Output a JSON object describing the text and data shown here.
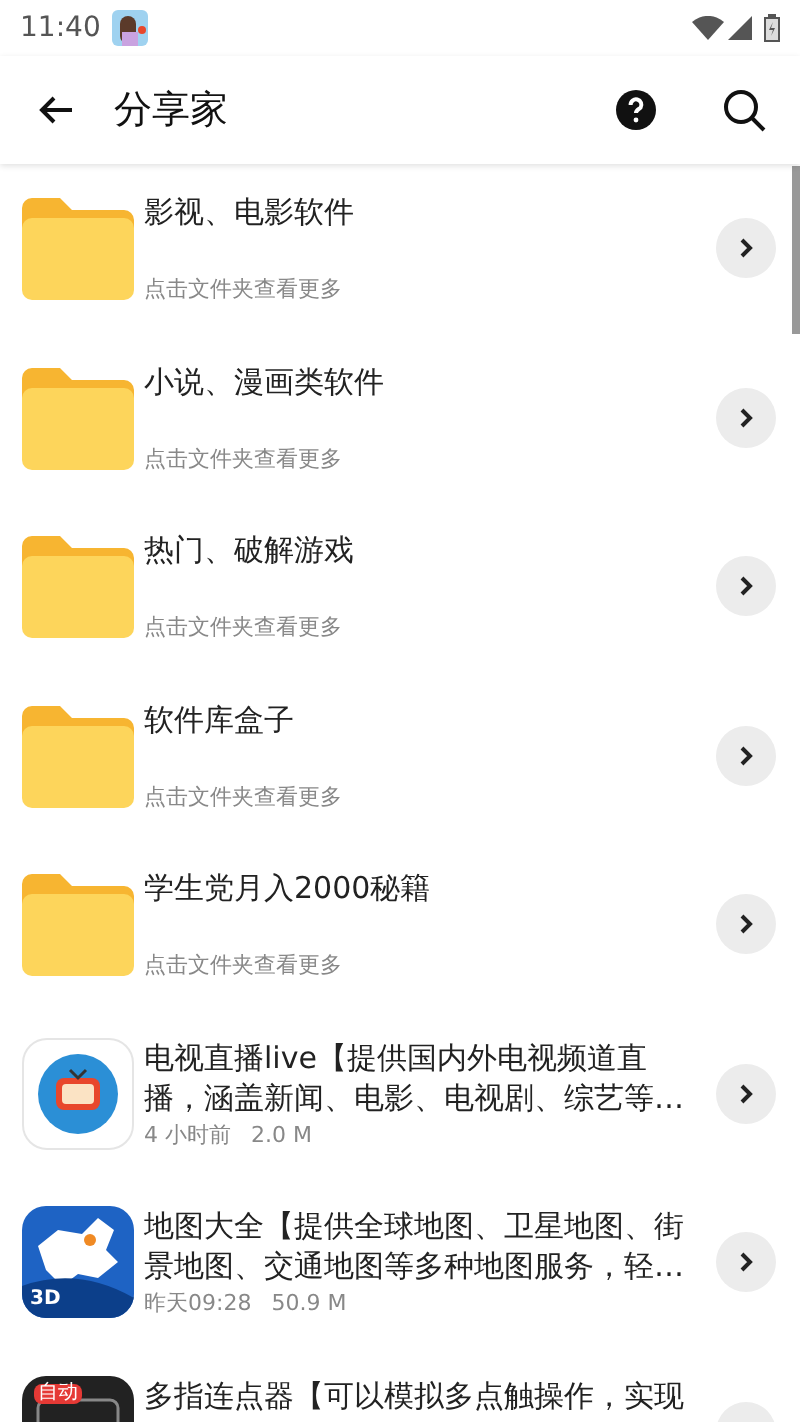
{
  "status_bar": {
    "time": "11:40"
  },
  "app_bar": {
    "title": "分享家"
  },
  "items": [
    {
      "kind": "folder",
      "title": "影视、电影软件",
      "subtitle": "点击文件夹查看更多"
    },
    {
      "kind": "folder",
      "title": "小说、漫画类软件",
      "subtitle": "点击文件夹查看更多"
    },
    {
      "kind": "folder",
      "title": "热门、破解游戏",
      "subtitle": "点击文件夹查看更多"
    },
    {
      "kind": "folder",
      "title": "软件库盒子",
      "subtitle": "点击文件夹查看更多"
    },
    {
      "kind": "folder",
      "title": "学生党月入2000秘籍",
      "subtitle": "点击文件夹查看更多"
    },
    {
      "kind": "app",
      "title": "电视直播live【提供国内外电视频道直播，涵盖新闻、电影、电视剧、综艺等…",
      "time": "4 小时前",
      "size": "2.0 M"
    },
    {
      "kind": "app",
      "badge": "3D",
      "title": "地图大全【提供全球地图、卫星地图、街景地图、交通地图等多种地图服务，轻…",
      "time": "昨天09:28",
      "size": "50.9 M"
    },
    {
      "kind": "app",
      "badge": "自动",
      "title": "多指连点器【可以模拟多点触操作，实现"
    }
  ]
}
